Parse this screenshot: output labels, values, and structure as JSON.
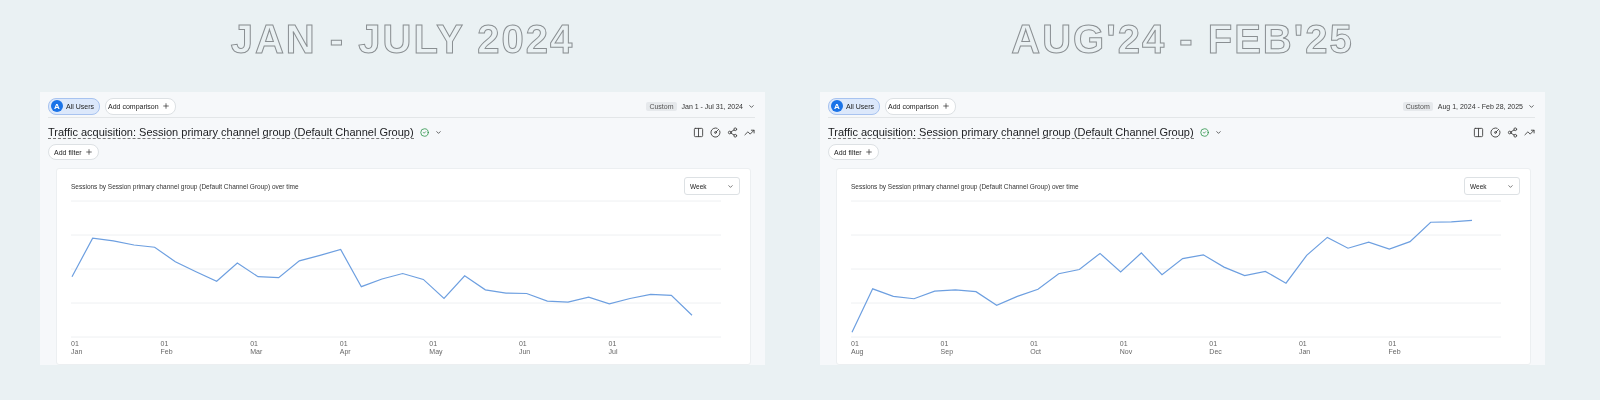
{
  "panels": [
    {
      "heading": "JAN - JULY 2024",
      "segment": {
        "avatar": "A",
        "label": "All Users"
      },
      "add_comparison": "Add comparison",
      "date_badge": "Custom",
      "date_range": "Jan 1 - Jul 31, 2024",
      "report_title": "Traffic acquisition: Session primary channel group (Default Channel Group)",
      "add_filter": "Add filter",
      "card_title": "Sessions by Session primary channel group (Default Channel Group) over time",
      "interval": "Week",
      "x_labels": [
        {
          "day": "01",
          "month": "Jan"
        },
        {
          "day": "01",
          "month": "Feb"
        },
        {
          "day": "01",
          "month": "Mar"
        },
        {
          "day": "01",
          "month": "Apr"
        },
        {
          "day": "01",
          "month": "May"
        },
        {
          "day": "01",
          "month": "Jun"
        },
        {
          "day": "01",
          "month": "Jul"
        }
      ]
    },
    {
      "heading": "AUG'24 - FEB'25",
      "segment": {
        "avatar": "A",
        "label": "All Users"
      },
      "add_comparison": "Add comparison",
      "date_badge": "Custom",
      "date_range": "Aug 1, 2024 - Feb 28, 2025",
      "report_title": "Traffic acquisition: Session primary channel group (Default Channel Group)",
      "add_filter": "Add filter",
      "card_title": "Sessions by Session primary channel group (Default Channel Group) over time",
      "interval": "Week",
      "x_labels": [
        {
          "day": "01",
          "month": "Aug"
        },
        {
          "day": "01",
          "month": "Sep"
        },
        {
          "day": "01",
          "month": "Oct"
        },
        {
          "day": "01",
          "month": "Nov"
        },
        {
          "day": "01",
          "month": "Dec"
        },
        {
          "day": "01",
          "month": "Jan"
        },
        {
          "day": "01",
          "month": "Feb"
        }
      ]
    }
  ]
}
